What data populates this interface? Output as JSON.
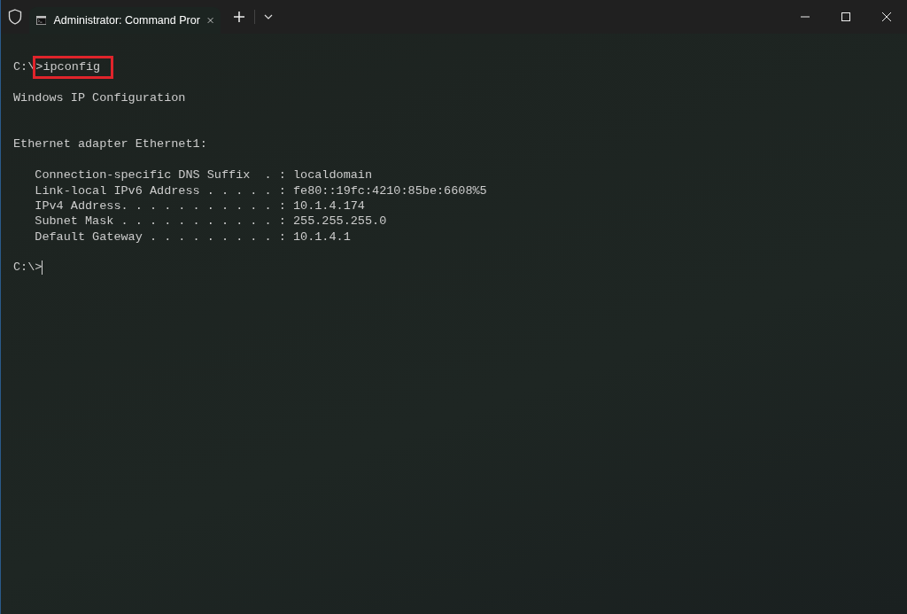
{
  "window": {
    "tab_title": "Administrator: Command Pror"
  },
  "terminal": {
    "lines": [
      {
        "kind": "blank"
      },
      {
        "kind": "command",
        "prompt": "C:\\",
        "command": ">ipconfig",
        "highlighted": true
      },
      {
        "kind": "blank"
      },
      {
        "kind": "text",
        "text": "Windows IP Configuration"
      },
      {
        "kind": "blank"
      },
      {
        "kind": "blank"
      },
      {
        "kind": "text",
        "text": "Ethernet adapter Ethernet1:"
      },
      {
        "kind": "blank"
      },
      {
        "kind": "text",
        "text": "   Connection-specific DNS Suffix  . : localdomain"
      },
      {
        "kind": "text",
        "text": "   Link-local IPv6 Address . . . . . : fe80::19fc:4210:85be:6608%5"
      },
      {
        "kind": "text",
        "text": "   IPv4 Address. . . . . . . . . . . : 10.1.4.174"
      },
      {
        "kind": "text",
        "text": "   Subnet Mask . . . . . . . . . . . : 255.255.255.0"
      },
      {
        "kind": "text",
        "text": "   Default Gateway . . . . . . . . . : 10.1.4.1"
      },
      {
        "kind": "blank"
      },
      {
        "kind": "prompt",
        "text": "C:\\>",
        "cursor": true
      }
    ]
  }
}
